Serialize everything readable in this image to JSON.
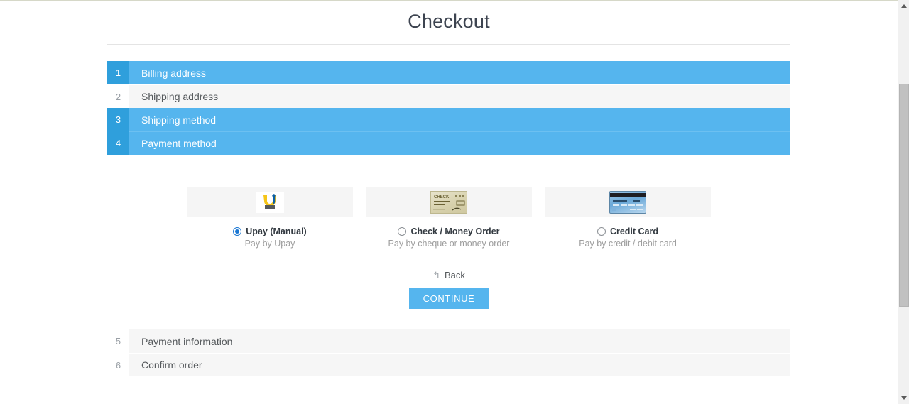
{
  "page": {
    "title": "Checkout"
  },
  "steps_top": [
    {
      "number": "1",
      "label": "Billing address",
      "state": "active"
    },
    {
      "number": "2",
      "label": "Shipping address",
      "state": "inactive"
    },
    {
      "number": "3",
      "label": "Shipping method",
      "state": "active"
    },
    {
      "number": "4",
      "label": "Payment method",
      "state": "active"
    }
  ],
  "steps_bottom": [
    {
      "number": "5",
      "label": "Payment information",
      "state": "inactive"
    },
    {
      "number": "6",
      "label": "Confirm order",
      "state": "inactive"
    }
  ],
  "payment_methods": [
    {
      "name": "Upay (Manual)",
      "description": "Pay by Upay",
      "selected": true,
      "logo_text": "Upay",
      "icon": "upay-logo-icon"
    },
    {
      "name": "Check / Money Order",
      "description": "Pay by cheque or money order",
      "selected": false,
      "logo_text": "CHECK",
      "icon": "check-document-icon"
    },
    {
      "name": "Credit Card",
      "description": "Pay by credit / debit card",
      "selected": false,
      "logo_text": "",
      "icon": "credit-card-icon"
    }
  ],
  "actions": {
    "back_label": "Back",
    "back_icon": "↰",
    "continue_label": "CONTINUE"
  },
  "colors": {
    "active_step_bg": "#55b5ee",
    "active_step_number_bg": "#2f9fdc",
    "inactive_step_bg": "#f6f6f6",
    "button_blue": "#55b5ee",
    "radio_selected": "#1b77d3",
    "title_text": "#3d4450",
    "muted_text": "#9d9d9d"
  },
  "scrollbar": {
    "up_arrow": "▲",
    "down_arrow": "▼"
  }
}
